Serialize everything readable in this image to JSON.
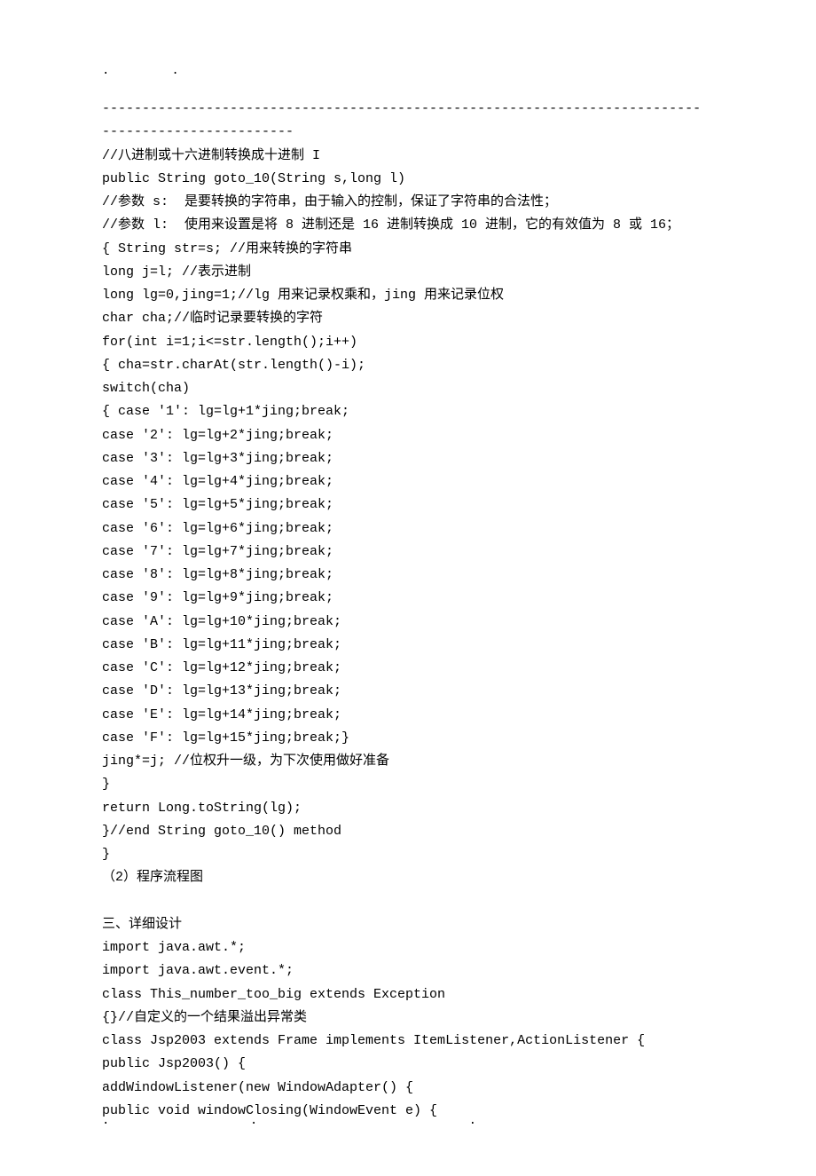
{
  "topDots": "..",
  "bottomDots": {
    "d1": ".",
    "d2": ".",
    "d3": "."
  },
  "lines": [
    "---------------------------------------------------------------------------",
    "------------------------",
    "//八进制或十六进制转换成十进制 I",
    "public String goto_10(String s,long l)",
    "//参数 s:  是要转换的字符串，由于输入的控制，保证了字符串的合法性；",
    "//参数 l:  使用来设置是将 8 进制还是 16 进制转换成 10 进制，它的有效值为 8 或 16；",
    "{ String str=s; //用来转换的字符串",
    "long j=l; //表示进制",
    "long lg=0,jing=1;//lg 用来记录权乘和，jing 用来记录位权",
    "char cha;//临时记录要转换的字符",
    "for(int i=1;i<=str.length();i++)",
    "{ cha=str.charAt(str.length()-i);",
    "switch(cha)",
    "{ case '1': lg=lg+1*jing;break;",
    "case '2': lg=lg+2*jing;break;",
    "case '3': lg=lg+3*jing;break;",
    "case '4': lg=lg+4*jing;break;",
    "case '5': lg=lg+5*jing;break;",
    "case '6': lg=lg+6*jing;break;",
    "case '7': lg=lg+7*jing;break;",
    "case '8': lg=lg+8*jing;break;",
    "case '9': lg=lg+9*jing;break;",
    "case 'A': lg=lg+10*jing;break;",
    "case 'B': lg=lg+11*jing;break;",
    "case 'C': lg=lg+12*jing;break;",
    "case 'D': lg=lg+13*jing;break;",
    "case 'E': lg=lg+14*jing;break;",
    "case 'F': lg=lg+15*jing;break;}",
    "jing*=j; //位权升一级，为下次使用做好准备",
    "}",
    "return Long.toString(lg);",
    "}//end String goto_10() method",
    "}",
    "（2）程序流程图",
    "",
    "三、详细设计",
    "import java.awt.*;",
    "import java.awt.event.*;",
    "class This_number_too_big extends Exception",
    "{}//自定义的一个结果溢出异常类",
    "class Jsp2003 extends Frame implements ItemListener,ActionListener {",
    "public Jsp2003() {",
    "addWindowListener(new WindowAdapter() {",
    "public void windowClosing(WindowEvent e) {"
  ]
}
